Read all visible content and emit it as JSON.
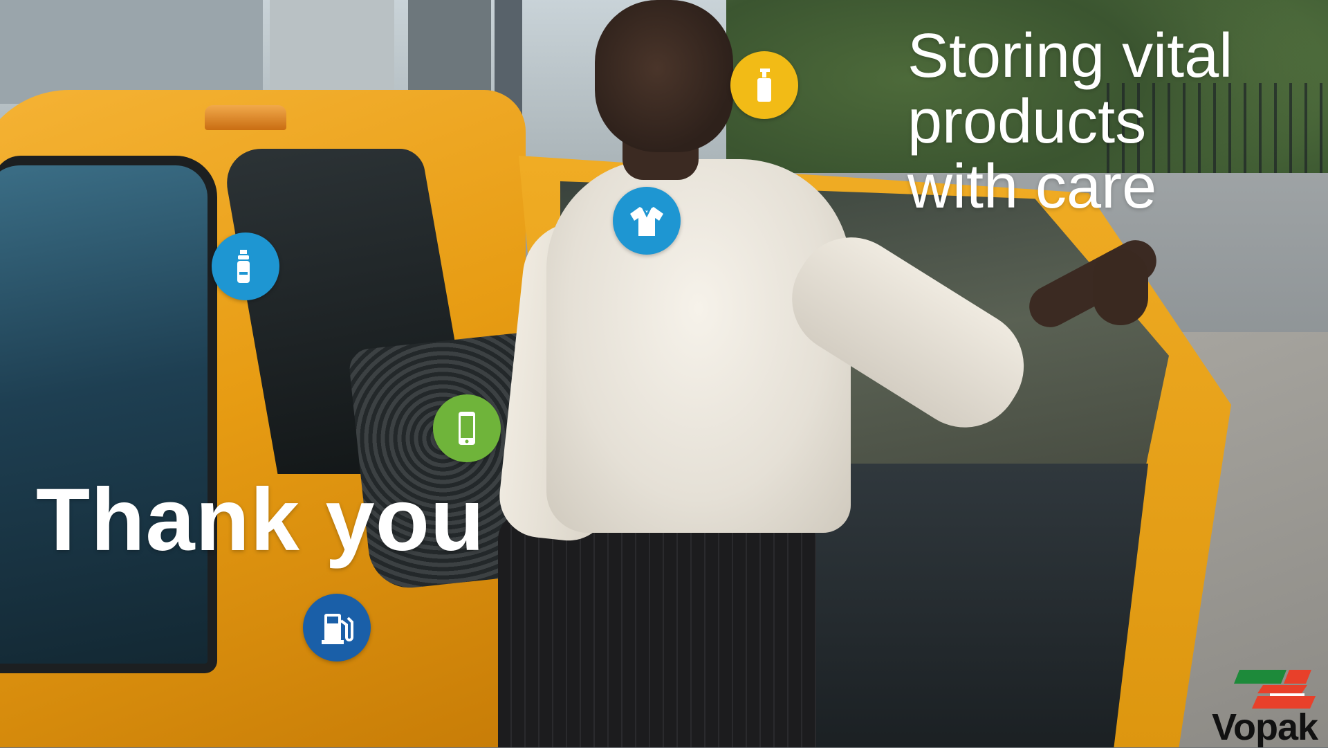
{
  "slide": {
    "closing_text": "Thank you",
    "tagline_lines": [
      "Storing vital",
      "products",
      "with care"
    ]
  },
  "icons": [
    {
      "name": "spray-can-icon",
      "color": "#1e96d2"
    },
    {
      "name": "dispenser-bottle-icon",
      "color": "#f2bb16"
    },
    {
      "name": "shirt-icon",
      "color": "#1e96d2"
    },
    {
      "name": "smartphone-icon",
      "color": "#6fb43a"
    },
    {
      "name": "fuel-pump-icon",
      "color": "#1a5fa8"
    }
  ],
  "brand": {
    "logo_text": "Vopak",
    "colors": {
      "green": "#1d8a3a",
      "red": "#e8402a",
      "text": "#111111"
    }
  }
}
